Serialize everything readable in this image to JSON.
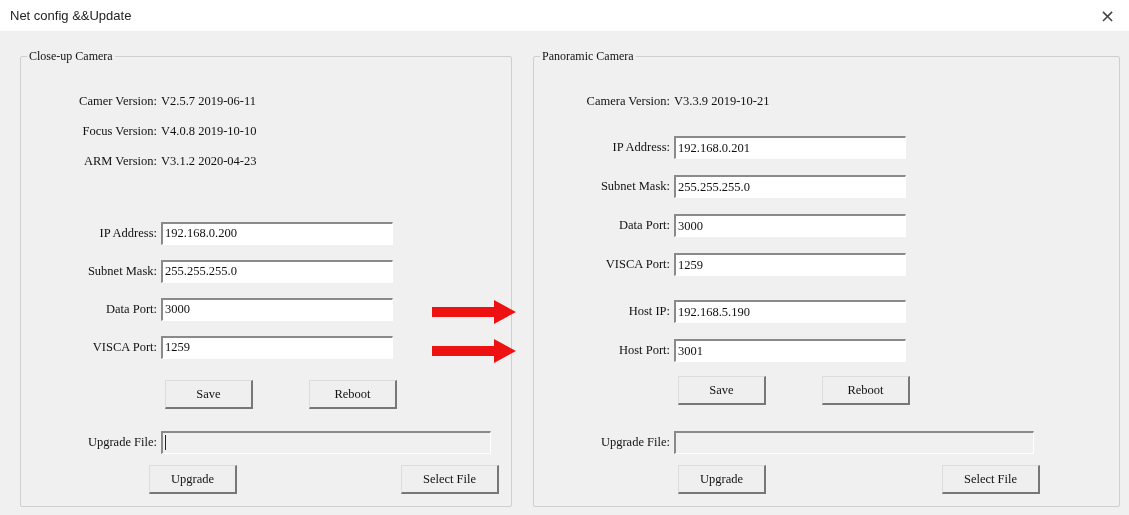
{
  "window": {
    "title": "Net config &&Update",
    "close": "×"
  },
  "panels": [
    {
      "title": "Close-up Camera",
      "versions": [
        {
          "label": "Camer Version:",
          "value": "V2.5.7 2019-06-11"
        },
        {
          "label": "Focus Version:",
          "value": "V4.0.8 2019-10-10"
        },
        {
          "label": "ARM Version:",
          "value": "V3.1.2 2020-04-23"
        }
      ],
      "fields": [
        {
          "label": "IP Address:",
          "value": "192.168.0.200",
          "annotated": false
        },
        {
          "label": "Subnet Mask:",
          "value": "255.255.255.0",
          "annotated": false
        },
        {
          "label": "Data Port:",
          "value": "3000",
          "annotated": false
        },
        {
          "label": "VISCA Port:",
          "value": "1259",
          "annotated": false
        }
      ],
      "buttons": [
        "Save",
        "Reboot"
      ],
      "upgrade": {
        "label": "Upgrade File:",
        "focused": true
      },
      "upgrade_buttons": [
        "Upgrade",
        "Select File"
      ]
    },
    {
      "title": "Panoramic Camera",
      "versions": [
        {
          "label": "Camera Version:",
          "value": "V3.3.9 2019-10-21"
        }
      ],
      "fields": [
        {
          "label": "IP Address:",
          "value": "192.168.0.201",
          "annotated": false
        },
        {
          "label": "Subnet Mask:",
          "value": "255.255.255.0",
          "annotated": false
        },
        {
          "label": "Data Port:",
          "value": "3000",
          "annotated": false
        },
        {
          "label": "VISCA Port:",
          "value": "1259",
          "annotated": false
        },
        {
          "label": "Host IP:",
          "value": "192.168.5.190",
          "annotated": true
        },
        {
          "label": "Host Port:",
          "value": "3001",
          "annotated": true
        }
      ],
      "buttons": [
        "Save",
        "Reboot"
      ],
      "upgrade": {
        "label": "Upgrade File:",
        "focused": false
      },
      "upgrade_buttons": [
        "Upgrade",
        "Select File"
      ]
    }
  ]
}
